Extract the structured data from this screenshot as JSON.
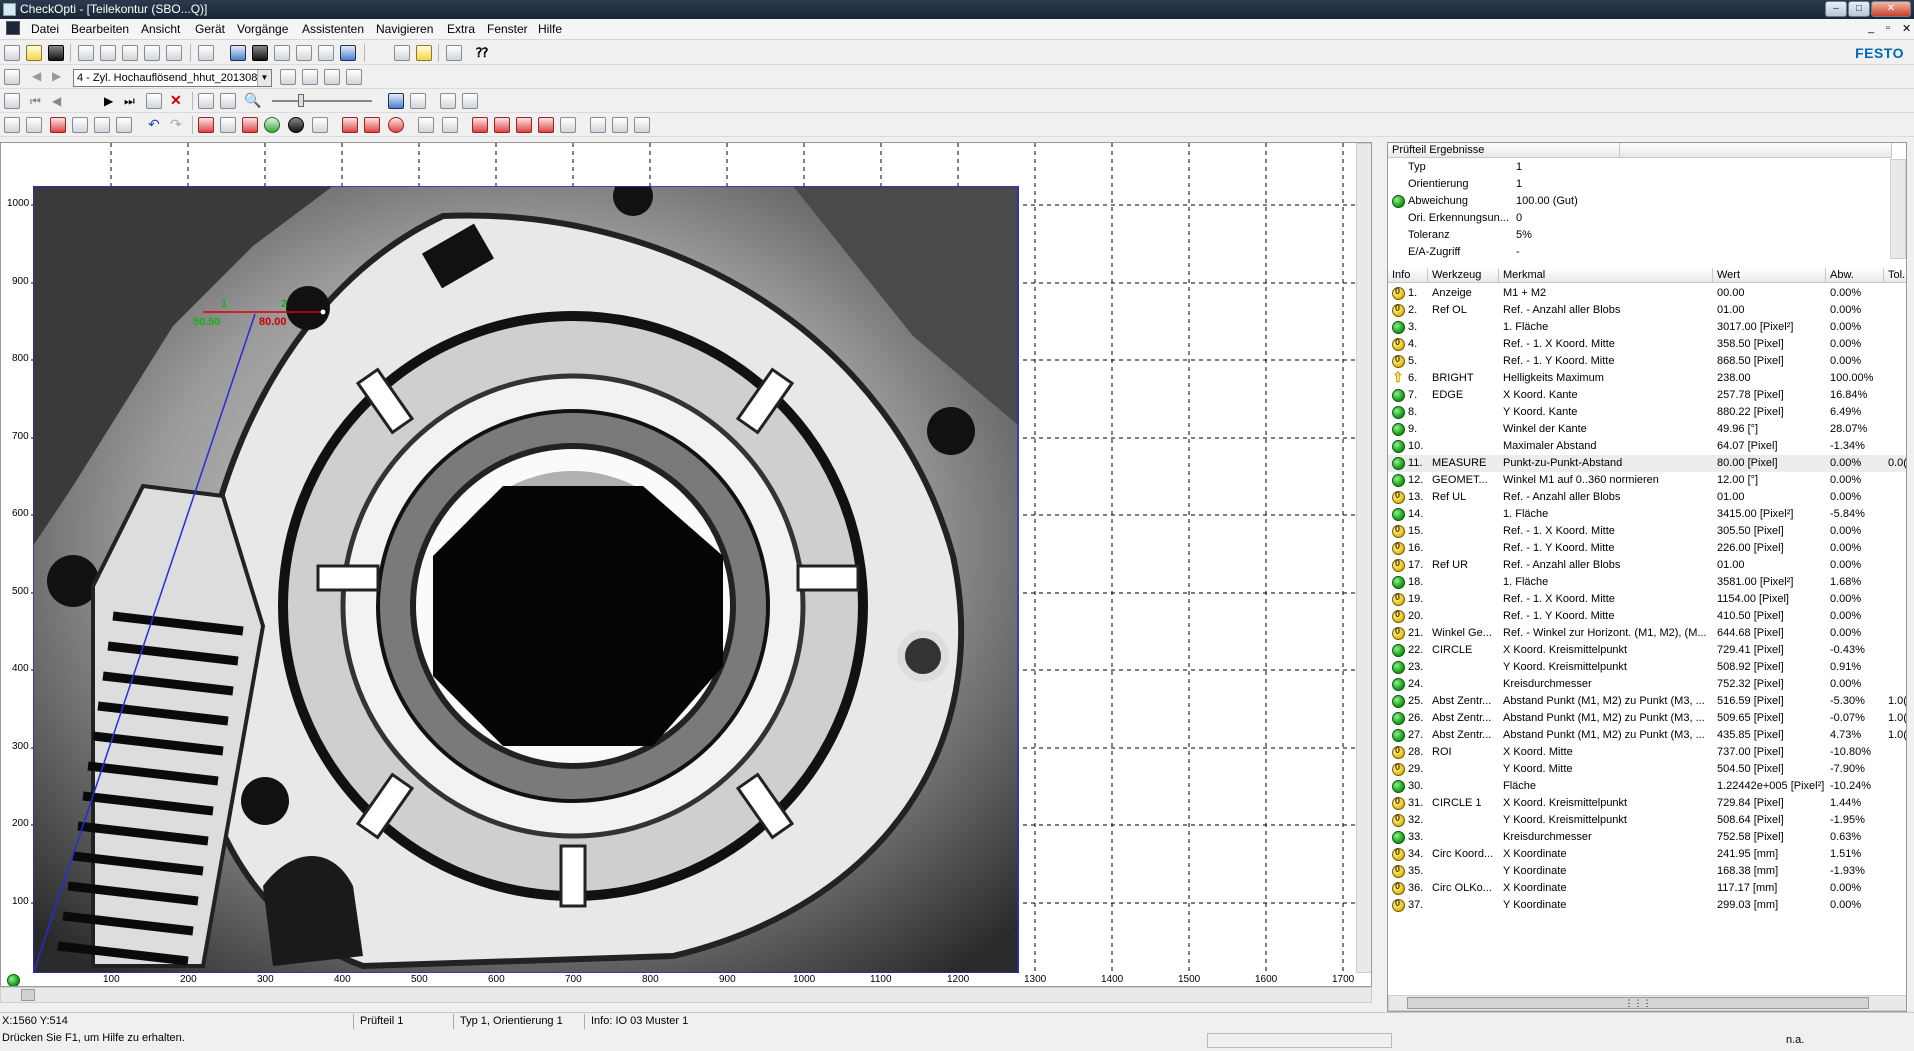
{
  "window": {
    "title": "CheckOpti - [Teilekontur (SBO...Q)]"
  },
  "menu": [
    "Datei",
    "Bearbeiten",
    "Ansicht",
    "Gerät",
    "Vorgänge",
    "Assistenten",
    "Navigieren",
    "Extra",
    "Fenster",
    "Hilfe"
  ],
  "brand": "FESTO",
  "toolbar": {
    "program_select": "4 - Zyl. Hochauflösend_hhut_201308"
  },
  "image_view": {
    "x_ticks": [
      "100",
      "200",
      "300",
      "400",
      "500",
      "600",
      "700",
      "800",
      "900",
      "1000",
      "1100",
      "1200",
      "1300",
      "1400",
      "1500",
      "1600",
      "1700"
    ],
    "y_ticks": [
      "1000",
      "900",
      "800",
      "700",
      "600",
      "500",
      "400",
      "300",
      "200",
      "100"
    ],
    "overlay": {
      "label1": "1",
      "label2": "2",
      "value1": "50.50",
      "value2": "80.00"
    }
  },
  "results_panel": {
    "title": "Prüfteil Ergebnisse",
    "summary": [
      {
        "label": "Typ",
        "value": "1",
        "status": ""
      },
      {
        "label": "Orientierung",
        "value": "1",
        "status": ""
      },
      {
        "label": "Abweichung",
        "value": "100.00 (Gut)",
        "status": "ok"
      },
      {
        "label": "Ori. Erkennungsun...",
        "value": "0",
        "status": ""
      },
      {
        "label": "Toleranz",
        "value": "5%",
        "status": ""
      },
      {
        "label": "E/A-Zugriff",
        "value": "-",
        "status": ""
      }
    ],
    "columns": [
      "Info",
      "Werkzeug",
      "Merkmal",
      "Wert",
      "Abw.",
      "Tol."
    ],
    "rows": [
      {
        "n": "1.",
        "tool": "Anzeige",
        "feature": "M1 + M2",
        "value": "00.00",
        "dev": "0.00%",
        "tol": "",
        "status": "o"
      },
      {
        "n": "2.",
        "tool": "Ref OL",
        "feature": "Ref. - Anzahl aller Blobs",
        "value": "01.00",
        "dev": "0.00%",
        "tol": "",
        "status": "o"
      },
      {
        "n": "3.",
        "tool": "",
        "feature": "1. Fläche",
        "value": "3017.00 [Pixel²]",
        "dev": "0.00%",
        "tol": "",
        "status": "g"
      },
      {
        "n": "4.",
        "tool": "",
        "feature": "Ref. - 1. X Koord. Mitte",
        "value": "358.50 [Pixel]",
        "dev": "0.00%",
        "tol": "",
        "status": "o"
      },
      {
        "n": "5.",
        "tool": "",
        "feature": "Ref. - 1. Y Koord. Mitte",
        "value": "868.50 [Pixel]",
        "dev": "0.00%",
        "tol": "",
        "status": "o"
      },
      {
        "n": "6.",
        "tool": "BRIGHT",
        "feature": "Helligkeits Maximum",
        "value": "238.00",
        "dev": "100.00%",
        "tol": "",
        "status": "u"
      },
      {
        "n": "7.",
        "tool": "EDGE",
        "feature": "X Koord. Kante",
        "value": "257.78 [Pixel]",
        "dev": "16.84%",
        "tol": "",
        "status": "g"
      },
      {
        "n": "8.",
        "tool": "",
        "feature": "Y Koord. Kante",
        "value": "880.22 [Pixel]",
        "dev": "6.49%",
        "tol": "",
        "status": "g"
      },
      {
        "n": "9.",
        "tool": "",
        "feature": "Winkel der Kante",
        "value": "49.96 [°]",
        "dev": "28.07%",
        "tol": "",
        "status": "g"
      },
      {
        "n": "10.",
        "tool": "",
        "feature": "Maximaler Abstand",
        "value": "64.07 [Pixel]",
        "dev": "-1.34%",
        "tol": "",
        "status": "g"
      },
      {
        "n": "11.",
        "tool": "MEASURE",
        "feature": "Punkt-zu-Punkt-Abstand",
        "value": "80.00 [Pixel]",
        "dev": "0.00%",
        "tol": "0.0(",
        "status": "g"
      },
      {
        "n": "12.",
        "tool": "GEOMET...",
        "feature": "Winkel M1 auf 0..360 normieren",
        "value": "12.00 [°]",
        "dev": "0.00%",
        "tol": "",
        "status": "g"
      },
      {
        "n": "13.",
        "tool": "Ref UL",
        "feature": "Ref. - Anzahl aller Blobs",
        "value": "01.00",
        "dev": "0.00%",
        "tol": "",
        "status": "o"
      },
      {
        "n": "14.",
        "tool": "",
        "feature": "1. Fläche",
        "value": "3415.00 [Pixel²]",
        "dev": "-5.84%",
        "tol": "",
        "status": "g"
      },
      {
        "n": "15.",
        "tool": "",
        "feature": "Ref. - 1. X Koord. Mitte",
        "value": "305.50 [Pixel]",
        "dev": "0.00%",
        "tol": "",
        "status": "o"
      },
      {
        "n": "16.",
        "tool": "",
        "feature": "Ref. - 1. Y Koord. Mitte",
        "value": "226.00 [Pixel]",
        "dev": "0.00%",
        "tol": "",
        "status": "o"
      },
      {
        "n": "17.",
        "tool": "Ref UR",
        "feature": "Ref. - Anzahl aller Blobs",
        "value": "01.00",
        "dev": "0.00%",
        "tol": "",
        "status": "o"
      },
      {
        "n": "18.",
        "tool": "",
        "feature": "1. Fläche",
        "value": "3581.00 [Pixel²]",
        "dev": "1.68%",
        "tol": "",
        "status": "g"
      },
      {
        "n": "19.",
        "tool": "",
        "feature": "Ref. - 1. X Koord. Mitte",
        "value": "1154.00 [Pixel]",
        "dev": "0.00%",
        "tol": "",
        "status": "o"
      },
      {
        "n": "20.",
        "tool": "",
        "feature": "Ref. - 1. Y Koord. Mitte",
        "value": "410.50 [Pixel]",
        "dev": "0.00%",
        "tol": "",
        "status": "o"
      },
      {
        "n": "21.",
        "tool": "Winkel Ge...",
        "feature": "Ref. - Winkel zur Horizont. (M1, M2), (M...",
        "value": "644.68 [Pixel]",
        "dev": "0.00%",
        "tol": "",
        "status": "o"
      },
      {
        "n": "22.",
        "tool": "CIRCLE",
        "feature": "X Koord. Kreismittelpunkt",
        "value": "729.41 [Pixel]",
        "dev": "-0.43%",
        "tol": "",
        "status": "g"
      },
      {
        "n": "23.",
        "tool": "",
        "feature": "Y Koord. Kreismittelpunkt",
        "value": "508.92 [Pixel]",
        "dev": "0.91%",
        "tol": "",
        "status": "g"
      },
      {
        "n": "24.",
        "tool": "",
        "feature": "Kreisdurchmesser",
        "value": "752.32 [Pixel]",
        "dev": "0.00%",
        "tol": "",
        "status": "g"
      },
      {
        "n": "25.",
        "tool": "Abst Zentr...",
        "feature": "Abstand Punkt (M1, M2) zu Punkt (M3, ...",
        "value": "516.59 [Pixel]",
        "dev": "-5.30%",
        "tol": "1.0(",
        "status": "g"
      },
      {
        "n": "26.",
        "tool": "Abst Zentr...",
        "feature": "Abstand Punkt (M1, M2) zu Punkt (M3, ...",
        "value": "509.65 [Pixel]",
        "dev": "-0.07%",
        "tol": "1.0(",
        "status": "g"
      },
      {
        "n": "27.",
        "tool": "Abst Zentr...",
        "feature": "Abstand Punkt (M1, M2) zu Punkt (M3, ...",
        "value": "435.85 [Pixel]",
        "dev": "4.73%",
        "tol": "1.0(",
        "status": "g"
      },
      {
        "n": "28.",
        "tool": "ROI",
        "feature": "X Koord. Mitte",
        "value": "737.00 [Pixel]",
        "dev": "-10.80%",
        "tol": "",
        "status": "o"
      },
      {
        "n": "29.",
        "tool": "",
        "feature": "Y Koord. Mitte",
        "value": "504.50 [Pixel]",
        "dev": "-7.90%",
        "tol": "",
        "status": "o"
      },
      {
        "n": "30.",
        "tool": "",
        "feature": "Fläche",
        "value": "1.22442e+005 [Pixel²]",
        "dev": "-10.24%",
        "tol": "",
        "status": "g"
      },
      {
        "n": "31.",
        "tool": "CIRCLE 1",
        "feature": "X Koord. Kreismittelpunkt",
        "value": "729.84 [Pixel]",
        "dev": "1.44%",
        "tol": "",
        "status": "o"
      },
      {
        "n": "32.",
        "tool": "",
        "feature": "Y Koord. Kreismittelpunkt",
        "value": "508.64 [Pixel]",
        "dev": "-1.95%",
        "tol": "",
        "status": "o"
      },
      {
        "n": "33.",
        "tool": "",
        "feature": "Kreisdurchmesser",
        "value": "752.58 [Pixel]",
        "dev": "0.63%",
        "tol": "",
        "status": "g"
      },
      {
        "n": "34.",
        "tool": "Circ Koord...",
        "feature": "X Koordinate",
        "value": "241.95 [mm]",
        "dev": "1.51%",
        "tol": "",
        "status": "o"
      },
      {
        "n": "35.",
        "tool": "",
        "feature": "Y Koordinate",
        "value": "168.38 [mm]",
        "dev": "-1.93%",
        "tol": "",
        "status": "o"
      },
      {
        "n": "36.",
        "tool": "Circ OLKo...",
        "feature": "X Koordinate",
        "value": "117.17 [mm]",
        "dev": "0.00%",
        "tol": "",
        "status": "o"
      },
      {
        "n": "37.",
        "tool": "",
        "feature": "Y Koordinate",
        "value": "299.03 [mm]",
        "dev": "0.00%",
        "tol": "",
        "status": "o"
      }
    ]
  },
  "status": {
    "coords": "X:1560 Y:514",
    "part": "Prüfteil 1",
    "type": "Typ 1, Orientierung 1",
    "info": "Info: IO 03 Muster 1",
    "help": "Drücken Sie F1, um Hilfe zu erhalten.",
    "na": "n.a."
  }
}
